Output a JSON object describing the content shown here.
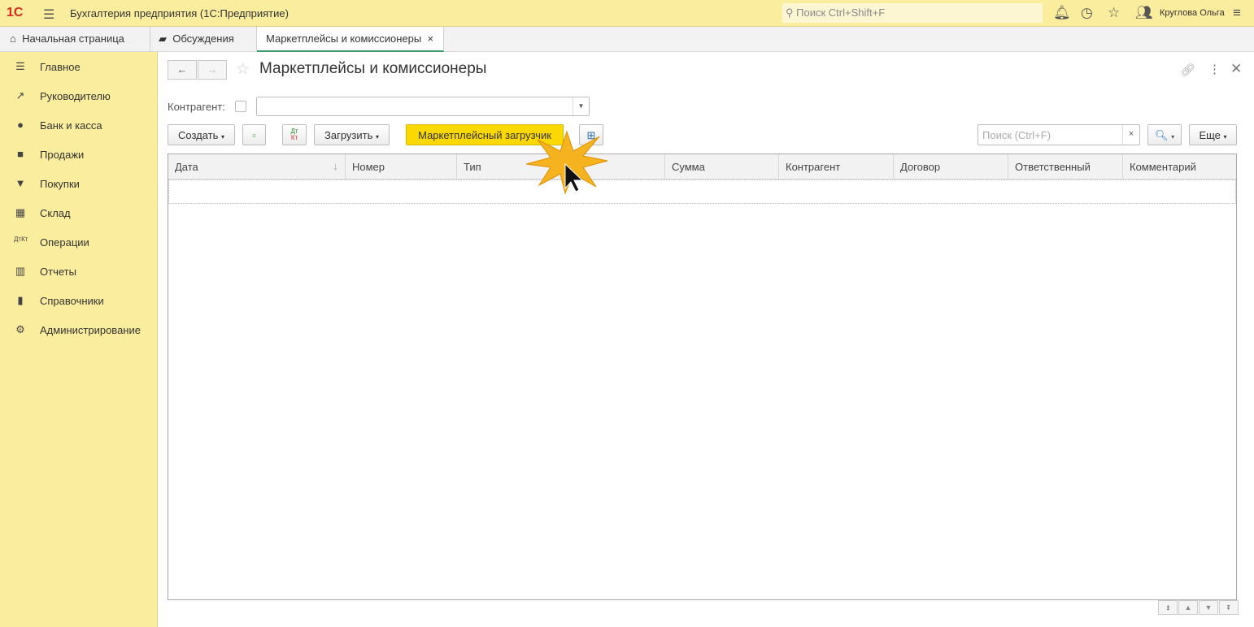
{
  "app": {
    "title": "Бухгалтерия предприятия  (1С:Предприятие)",
    "search_placeholder": "Поиск Ctrl+Shift+F",
    "user": "Круглова Ольга"
  },
  "tabs": [
    {
      "label": "Начальная страница"
    },
    {
      "label": "Обсуждения"
    },
    {
      "label": "Маркетплейсы и комиссионеры"
    }
  ],
  "sidebar": [
    {
      "label": "Главное"
    },
    {
      "label": "Руководителю"
    },
    {
      "label": "Банк и касса"
    },
    {
      "label": "Продажи"
    },
    {
      "label": "Покупки"
    },
    {
      "label": "Склад"
    },
    {
      "label": "Операции"
    },
    {
      "label": "Отчеты"
    },
    {
      "label": "Справочники"
    },
    {
      "label": "Администрирование"
    }
  ],
  "form": {
    "title": "Маркетплейсы и комиссионеры",
    "counterparty_label": "Контрагент:",
    "counterparty_value": ""
  },
  "toolbar": {
    "create": "Создать",
    "load": "Загрузить",
    "marketplace_loader": "Маркетплейсный загрузчик",
    "search_placeholder": "Поиск (Ctrl+F)",
    "more": "Еще",
    "dtkt_top": "Дт",
    "dtkt_bottom": "Кт"
  },
  "table": {
    "columns": [
      "Дата",
      "Номер",
      "Тип",
      "Сумма",
      "Контрагент",
      "Договор",
      "Ответственный",
      "Комментарий"
    ]
  },
  "colors": {
    "accent": "#fbd800",
    "sidebar": "#fbed9e"
  }
}
